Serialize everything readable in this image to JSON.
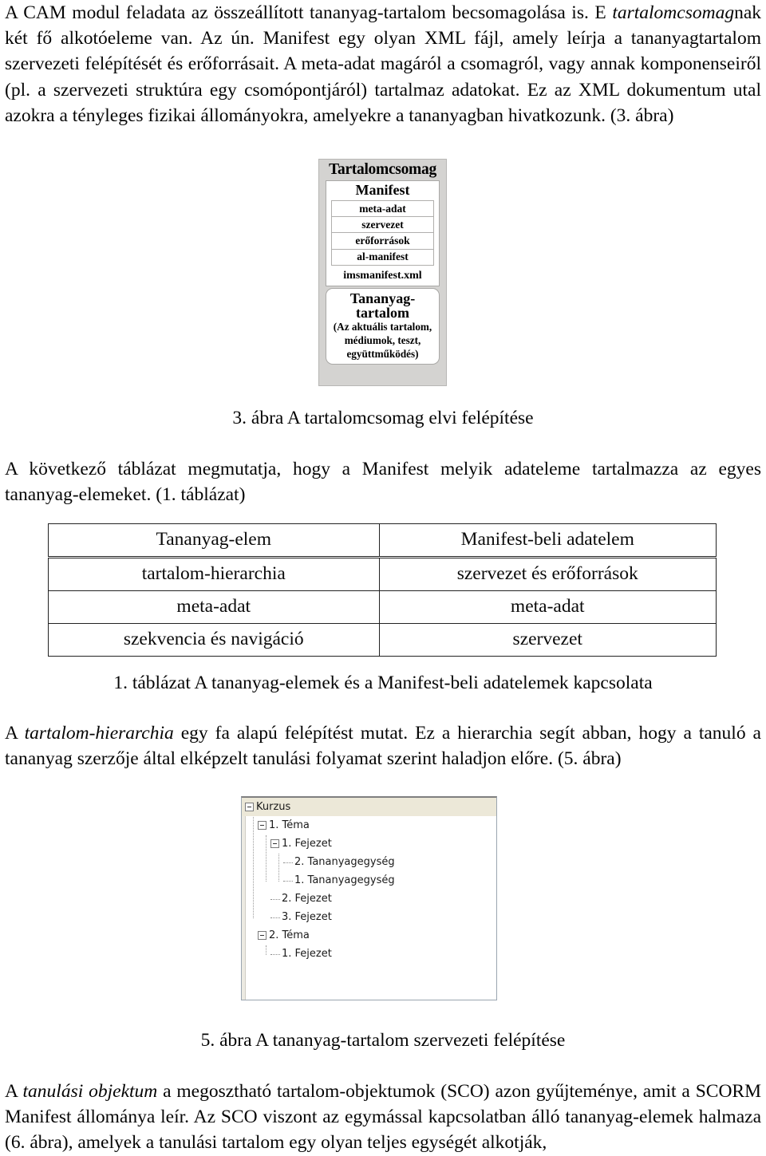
{
  "paragraphs": {
    "intro_1": "A CAM modul feladata az összeállított tananyag-tartalom becsomagolása is. E ",
    "intro_italic": "tartalomcsomag",
    "intro_2": "nak két fő alkotóeleme van. Az ún. Manifest egy olyan XML fájl, amely leírja a tananyagtartalom szervezeti felépítését és erőforrásait. A meta-adat magáról a csomagról, vagy annak komponenseiről (pl. a szervezeti struktúra egy csomópontjáról) tartalmaz adatokat. Ez az XML dokumentum utal azokra a tényleges fizikai állományokra, amelyekre a tananyagban hivatkozunk. (3. ábra)",
    "table_lead": "A következő táblázat megmutatja, hogy a Manifest melyik adateleme tartalmazza az egyes tananyag-elemeket. (1. táblázat)",
    "hierarchy_1": "A ",
    "hierarchy_italic": "tartalom-hierarchia",
    "hierarchy_2": " egy fa alapú felépítést mutat. Ez a hierarchia segít abban, hogy a tanuló a tananyag szerzője által elképzelt tanulási folyamat szerint haladjon előre. (5. ábra)",
    "objektum_1": "A ",
    "objektum_italic": "tanulási objektum",
    "objektum_2": " a megosztható tartalom-objektumok (SCO) azon gyűjteménye, amit a SCORM Manifest állománya leír. Az SCO viszont az egymással kapcsolatban álló tananyag-elemek halmaza (6. ábra), amelyek a tanulási tartalom egy olyan teljes egységét alkotják,"
  },
  "captions": {
    "figure3": "3. ábra A tartalomcsomag elvi felépítése",
    "table1": "1. táblázat A tananyag-elemek és a Manifest-beli adatelemek kapcsolata",
    "figure5": "5. ábra A tananyag-tartalom szervezeti felépítése"
  },
  "figure3": {
    "package_title": "Tartalomcsomag",
    "manifest_title": "Manifest",
    "manifest_rows": [
      "meta-adat",
      "szervezet",
      "erőforrások",
      "al-manifest"
    ],
    "manifest_file": "imsmanifest.xml",
    "content_title_line1": "Tananyag-",
    "content_title_line2": "tartalom",
    "content_sub_line1": "(Az aktuális tartalom,",
    "content_sub_line2": "médiumok, teszt,",
    "content_sub_line3": "együttműködés)",
    "colors": {
      "package_bg": "#d4d3d1",
      "inner_bg": "#ffffff",
      "border": "#a9a8a6"
    }
  },
  "table1": {
    "headers": [
      "Tananyag-elem",
      "Manifest-beli adatelem"
    ],
    "rows": [
      [
        "tartalom-hierarchia",
        "szervezet és erőforrások"
      ],
      [
        "meta-adat",
        "meta-adat"
      ],
      [
        "szekvencia és navigáció",
        "szervezet"
      ]
    ]
  },
  "figure5": {
    "nodes": [
      {
        "label": "Kurzus",
        "depth": 0,
        "expander": "minus",
        "selected": true
      },
      {
        "label": "1. Téma",
        "depth": 1,
        "expander": "minus",
        "selected": false
      },
      {
        "label": "1. Fejezet",
        "depth": 2,
        "expander": "minus",
        "selected": false
      },
      {
        "label": "2. Tananyagegység",
        "depth": 3,
        "expander": "leaf",
        "selected": false
      },
      {
        "label": "1. Tananyagegység",
        "depth": 3,
        "expander": "leaf",
        "selected": false
      },
      {
        "label": "2. Fejezet",
        "depth": 2,
        "expander": "leaf",
        "selected": false
      },
      {
        "label": "3. Fejezet",
        "depth": 2,
        "expander": "leaf",
        "selected": false
      },
      {
        "label": "2. Téma",
        "depth": 1,
        "expander": "minus",
        "selected": false
      },
      {
        "label": "1. Fejezet",
        "depth": 2,
        "expander": "leaf",
        "selected": false
      }
    ],
    "colors": {
      "selected_row_bg": "#ece8d8",
      "panel_border": "#9aa5b0",
      "guide_line": "#9a9a9a"
    }
  }
}
